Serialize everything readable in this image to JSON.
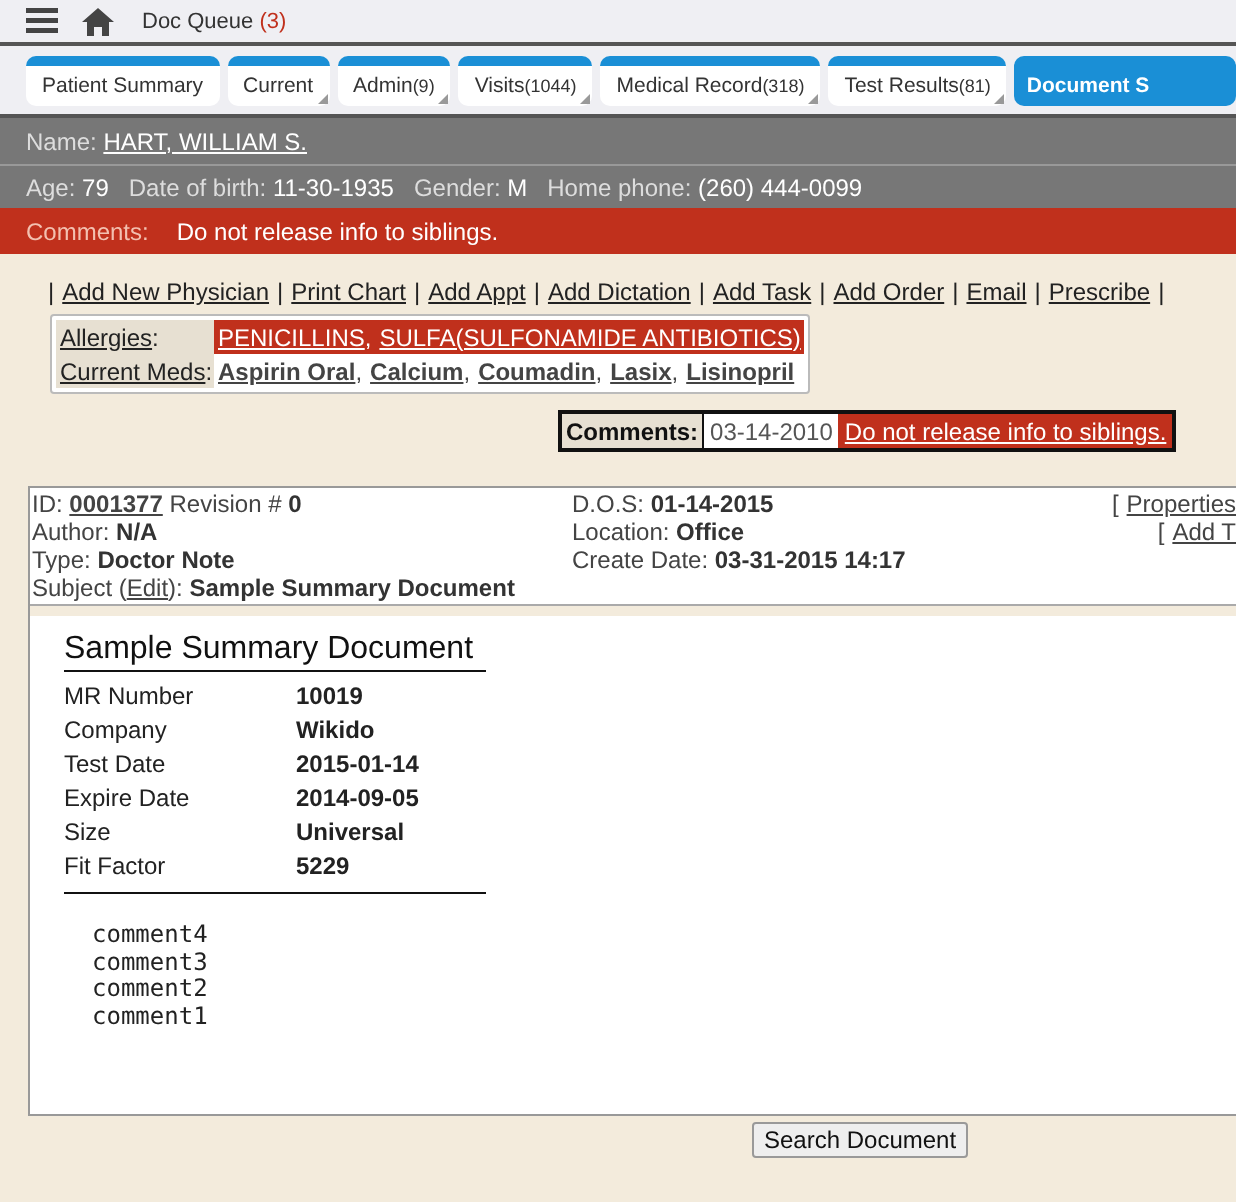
{
  "header": {
    "title": "Doc Queue",
    "count": "(3)"
  },
  "tabs": [
    {
      "label": "Patient Summary",
      "dropdown": false,
      "selected": false
    },
    {
      "label": "Current",
      "dropdown": true,
      "selected": false
    },
    {
      "label": "Admin",
      "count": "(9)",
      "dropdown": true,
      "selected": false
    },
    {
      "label": "Visits",
      "count": "(1044)",
      "dropdown": true,
      "selected": false
    },
    {
      "label": "Medical Record",
      "count": "(318)",
      "dropdown": true,
      "selected": false
    },
    {
      "label": "Test Results",
      "count": "(81)",
      "dropdown": true,
      "selected": false
    },
    {
      "label": "Document S",
      "dropdown": false,
      "selected": true
    }
  ],
  "patient": {
    "name_label": "Name:",
    "name": "HART, WILLIAM S.",
    "fields": [
      {
        "label": "Age:",
        "value": "79"
      },
      {
        "label": "Date of birth:",
        "value": "11-30-1935"
      },
      {
        "label": "Gender:",
        "value": "M"
      },
      {
        "label": "Home phone:",
        "value": "(260) 444-0099"
      }
    ],
    "comments_label": "Comments:",
    "comments": "Do not release info to siblings."
  },
  "action_separator": "|",
  "actions": [
    "Add New Physician",
    "Print Chart",
    "Add Appt",
    "Add Dictation",
    "Add Task",
    "Add Order",
    "Email",
    "Prescribe"
  ],
  "allergies": {
    "label": "Allergies",
    "punct": ":",
    "separator": ",",
    "items": [
      "PENICILLINS",
      "SULFA(SULFONAMIDE ANTIBIOTICS)"
    ]
  },
  "current_meds": {
    "label": "Current Meds",
    "punct": ":",
    "separator": ",",
    "items": [
      "Aspirin Oral",
      "Calcium",
      "Coumadin",
      "Lasix",
      "Lisinopril"
    ]
  },
  "comment_box": {
    "label": "Comments:",
    "date": "03-14-2010",
    "text": "Do not release info to siblings."
  },
  "document": {
    "id_label": "ID:",
    "id": "0001377",
    "revision_label": "Revision #",
    "revision": "0",
    "author_label": "Author:",
    "author": "N/A",
    "type_label": "Type:",
    "type": "Doctor Note",
    "subject_label": "Subject (",
    "edit_link": "Edit",
    "subject_suffix": "):",
    "subject": "Sample Summary Document",
    "dos_label": "D.O.S:",
    "dos": "01-14-2015",
    "location_label": "Location:",
    "location": "Office",
    "create_label": "Create Date:",
    "create_date": "03-31-2015 14:17",
    "link_bracket": "[",
    "links": [
      "Properties",
      "Add T"
    ],
    "title": "Sample Summary Document",
    "rows": [
      {
        "label": "MR Number",
        "value": "10019"
      },
      {
        "label": "Company",
        "value": "Wikido"
      },
      {
        "label": "Test Date",
        "value": "2015-01-14"
      },
      {
        "label": "Expire Date",
        "value": "2014-09-05"
      },
      {
        "label": "Size",
        "value": "Universal"
      },
      {
        "label": "Fit Factor",
        "value": "5229"
      }
    ],
    "comments": [
      "comment4",
      "comment3",
      "comment2",
      "comment1"
    ]
  },
  "search_button": "Search Document"
}
